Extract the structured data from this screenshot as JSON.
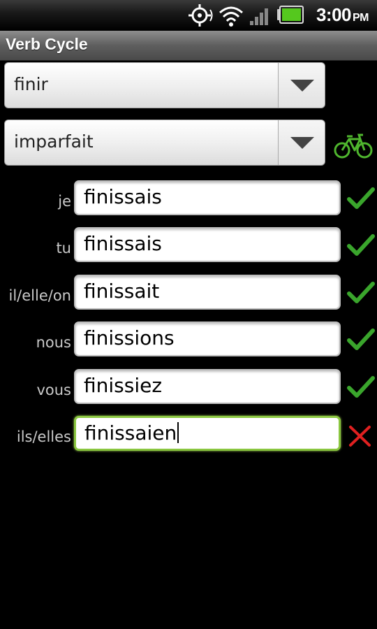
{
  "status": {
    "time": "3:00",
    "ampm": "PM",
    "icons": [
      "gps-icon",
      "wifi-icon",
      "signal-icon",
      "battery-icon"
    ],
    "battery_color": "#55c81e"
  },
  "app": {
    "title": "Verb Cycle"
  },
  "verb_spinner": {
    "value": "finir"
  },
  "tense_spinner": {
    "value": "imparfait"
  },
  "cycle_icon": "bicycle-icon",
  "colors": {
    "correct": "#3aa52c",
    "incorrect": "#e02020",
    "focus": "#8ac640"
  },
  "rows": [
    {
      "pronoun": "je",
      "answer": "finissais",
      "status": "correct"
    },
    {
      "pronoun": "tu",
      "answer": "finissais",
      "status": "correct"
    },
    {
      "pronoun": "il/elle/on",
      "answer": "finissait",
      "status": "correct"
    },
    {
      "pronoun": "nous",
      "answer": "finissions",
      "status": "correct"
    },
    {
      "pronoun": "vous",
      "answer": "finissiez",
      "status": "correct"
    },
    {
      "pronoun": "ils/elles",
      "answer": "finissaien",
      "status": "incorrect"
    }
  ]
}
